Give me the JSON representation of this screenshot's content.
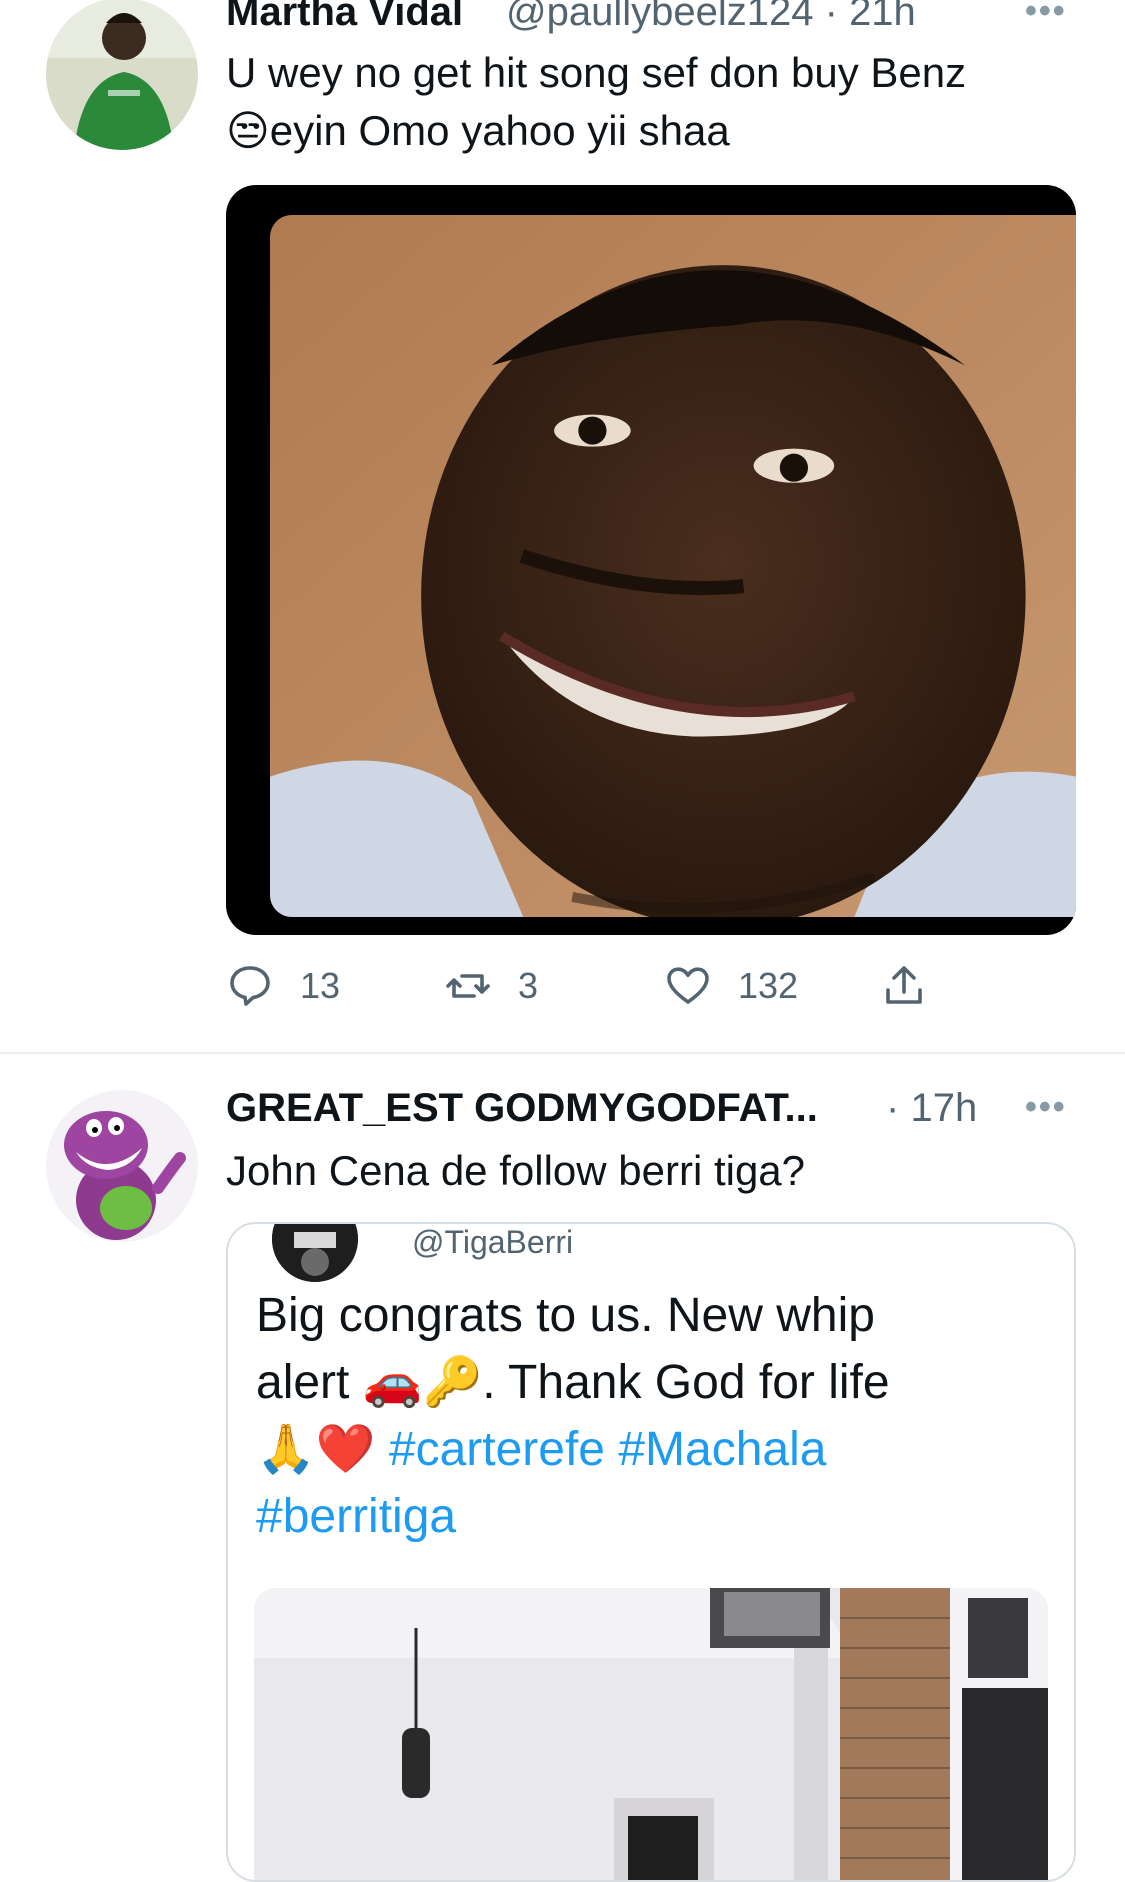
{
  "tweets": [
    {
      "author_name": "Martha Vidal",
      "handle": "@paullybeelz124",
      "separator": "·",
      "time": "21h",
      "text_line1": "U wey no get hit song sef don buy Benz",
      "text_line2_emoji": "😒",
      "text_line2": "eyin Omo yahoo yii shaa",
      "more_icon": "more-icon",
      "actions": {
        "replies": "13",
        "retweets": "3",
        "likes": "132"
      }
    },
    {
      "author_name": "GREAT_EST GODMYGODFAT...",
      "separator": "·",
      "time": "17h",
      "text": "John Cena de follow berri tiga?",
      "more_icon": "more-icon",
      "quoted": {
        "handle": "@TigaBerri",
        "line1": "Big congrats to us.   New whip",
        "line2_start": "alert ",
        "line2_emojis": "🚗🔑",
        "line2_end": ". Thank God for life",
        "line3_emojis": "🙏❤️",
        "hashtags_line3": [
          "#carterefe",
          "#Machala"
        ],
        "hashtags_line4": [
          "#berritiga"
        ]
      }
    }
  ],
  "colors": {
    "text_primary": "#0f1419",
    "text_secondary": "#536471",
    "hashtag": "#1d9bf0",
    "divider": "#e6ecf0"
  }
}
